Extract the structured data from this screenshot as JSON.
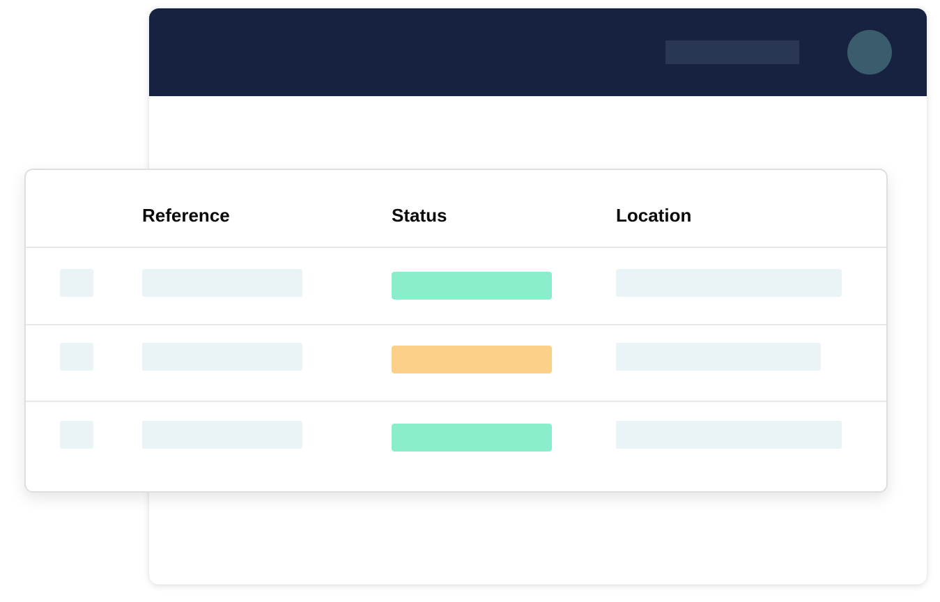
{
  "colors": {
    "header_bg": "#16223f",
    "skeleton": "#eaf3f6",
    "status_green": "#8aeecb",
    "status_orange": "#fcd088",
    "avatar": "#3a5c6d",
    "search_box": "#2a3752"
  },
  "table": {
    "columns": [
      "Reference",
      "Status",
      "Location"
    ],
    "rows": [
      {
        "status_color": "#8aeecb"
      },
      {
        "status_color": "#fcd088"
      },
      {
        "status_color": "#8aeecb"
      }
    ]
  }
}
